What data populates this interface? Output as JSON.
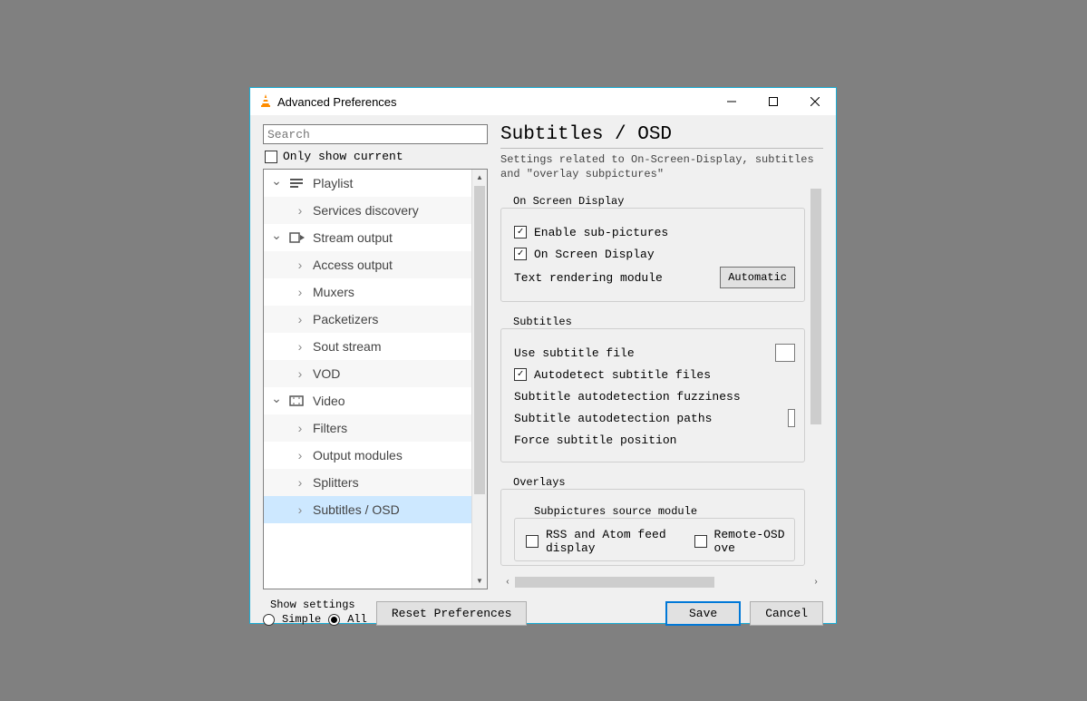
{
  "window": {
    "title": "Advanced Preferences"
  },
  "search": {
    "placeholder": "Search"
  },
  "only_show_current_label": "Only show current",
  "only_show_current_checked": false,
  "tree": {
    "nodes": [
      {
        "kind": "parent",
        "icon": "playlist",
        "label": "Playlist"
      },
      {
        "kind": "child",
        "label": "Services discovery"
      },
      {
        "kind": "parent",
        "icon": "stream",
        "label": "Stream output"
      },
      {
        "kind": "child",
        "label": "Access output"
      },
      {
        "kind": "child",
        "label": "Muxers"
      },
      {
        "kind": "child",
        "label": "Packetizers"
      },
      {
        "kind": "child",
        "label": "Sout stream"
      },
      {
        "kind": "child",
        "label": "VOD"
      },
      {
        "kind": "parent",
        "icon": "video",
        "label": "Video"
      },
      {
        "kind": "child",
        "label": "Filters"
      },
      {
        "kind": "child",
        "label": "Output modules"
      },
      {
        "kind": "child",
        "label": "Splitters"
      },
      {
        "kind": "child",
        "label": "Subtitles / OSD",
        "selected": true
      }
    ]
  },
  "right": {
    "title": "Subtitles / OSD",
    "description": "Settings related to On-Screen-Display, subtitles and \"overlay subpictures\"",
    "osd_group_label": "On Screen Display",
    "enable_subpictures_label": "Enable sub-pictures",
    "enable_subpictures_checked": true,
    "on_screen_display_label": "On Screen Display",
    "on_screen_display_checked": true,
    "text_rendering_label": "Text rendering module",
    "text_rendering_value": "Automatic",
    "subtitles_group_label": "Subtitles",
    "use_subtitle_file_label": "Use subtitle file",
    "autodetect_label": "Autodetect subtitle files",
    "autodetect_checked": true,
    "fuzziness_label": "Subtitle autodetection fuzziness",
    "paths_label": "Subtitle autodetection paths",
    "force_pos_label": "Force subtitle position",
    "overlays_group_label": "Overlays",
    "subpictures_source_label": "Subpictures source module",
    "rss_label": "RSS and Atom feed display",
    "rss_checked": false,
    "remote_osd_label": "Remote-OSD ove",
    "remote_osd_checked": false
  },
  "footer": {
    "show_settings_label": "Show settings",
    "simple_label": "Simple",
    "all_label": "All",
    "selected_mode": "All",
    "reset_label": "Reset Preferences",
    "save_label": "Save",
    "cancel_label": "Cancel"
  }
}
